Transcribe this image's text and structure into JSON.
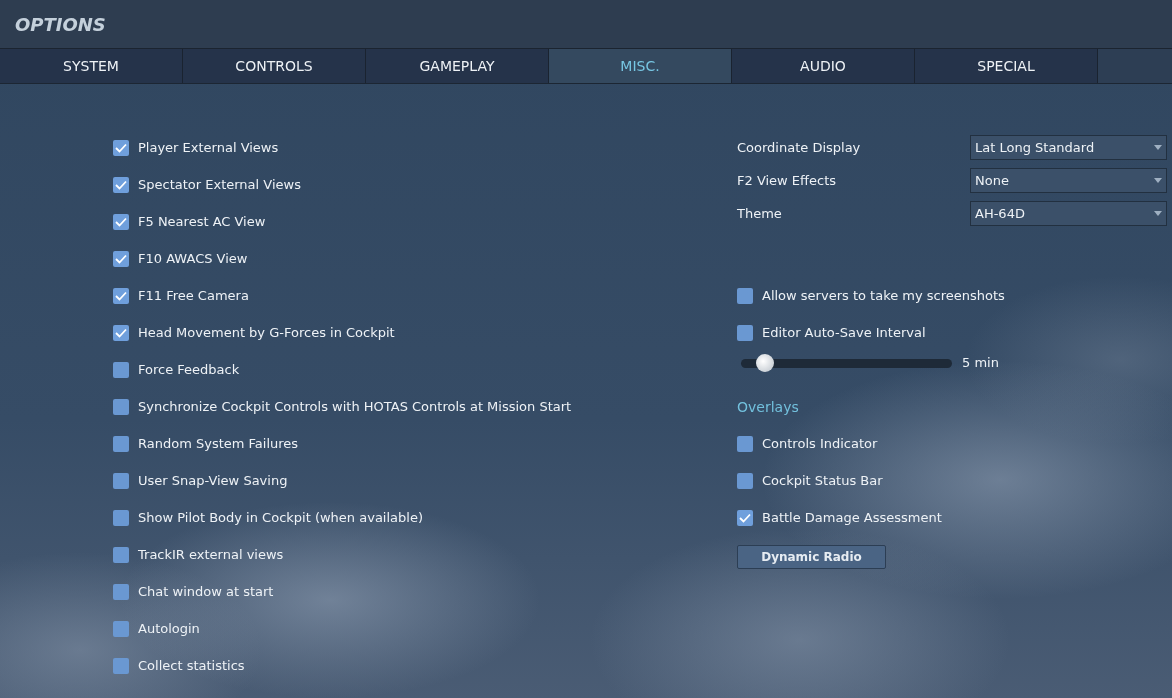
{
  "window": {
    "title": "OPTIONS"
  },
  "tabs": [
    {
      "label": "SYSTEM",
      "selected": false
    },
    {
      "label": "CONTROLS",
      "selected": false
    },
    {
      "label": "GAMEPLAY",
      "selected": false
    },
    {
      "label": "MISC.",
      "selected": true
    },
    {
      "label": "AUDIO",
      "selected": false
    },
    {
      "label": "SPECIAL",
      "selected": false
    }
  ],
  "left_options": [
    {
      "label": "Player External Views",
      "checked": true
    },
    {
      "label": "Spectator External Views",
      "checked": true
    },
    {
      "label": "F5 Nearest AC View",
      "checked": true
    },
    {
      "label": "F10 AWACS View",
      "checked": true
    },
    {
      "label": "F11 Free Camera",
      "checked": true
    },
    {
      "label": "Head Movement by G-Forces in Cockpit",
      "checked": true
    },
    {
      "label": "Force Feedback",
      "checked": false
    },
    {
      "label": "Synchronize Cockpit Controls with HOTAS Controls at Mission Start",
      "checked": false
    },
    {
      "label": "Random System Failures",
      "checked": false
    },
    {
      "label": "User Snap-View Saving",
      "checked": false
    },
    {
      "label": "Show Pilot Body in Cockpit (when available)",
      "checked": false
    },
    {
      "label": "TrackIR external views",
      "checked": false
    },
    {
      "label": "Chat window at start",
      "checked": false
    },
    {
      "label": "Autologin",
      "checked": false
    },
    {
      "label": "Collect statistics",
      "checked": false
    }
  ],
  "dropdowns": [
    {
      "label": "Coordinate Display",
      "value": "Lat Long Standard"
    },
    {
      "label": "F2 View Effects",
      "value": "None"
    },
    {
      "label": "Theme",
      "value": "AH-64D"
    }
  ],
  "right_options": [
    {
      "label": "Allow servers to take my screenshots",
      "checked": false
    },
    {
      "label": "Editor Auto-Save Interval",
      "checked": false
    }
  ],
  "autosave_slider": {
    "level": 0.08,
    "reading": "5 min"
  },
  "overlays": {
    "heading": "Overlays",
    "options": [
      {
        "label": "Controls Indicator",
        "checked": false
      },
      {
        "label": "Cockpit Status Bar",
        "checked": false
      },
      {
        "label": "Battle Damage Assessment",
        "checked": true
      }
    ]
  },
  "buttons": [
    {
      "label": "Dynamic Radio",
      "disabled": false
    }
  ]
}
